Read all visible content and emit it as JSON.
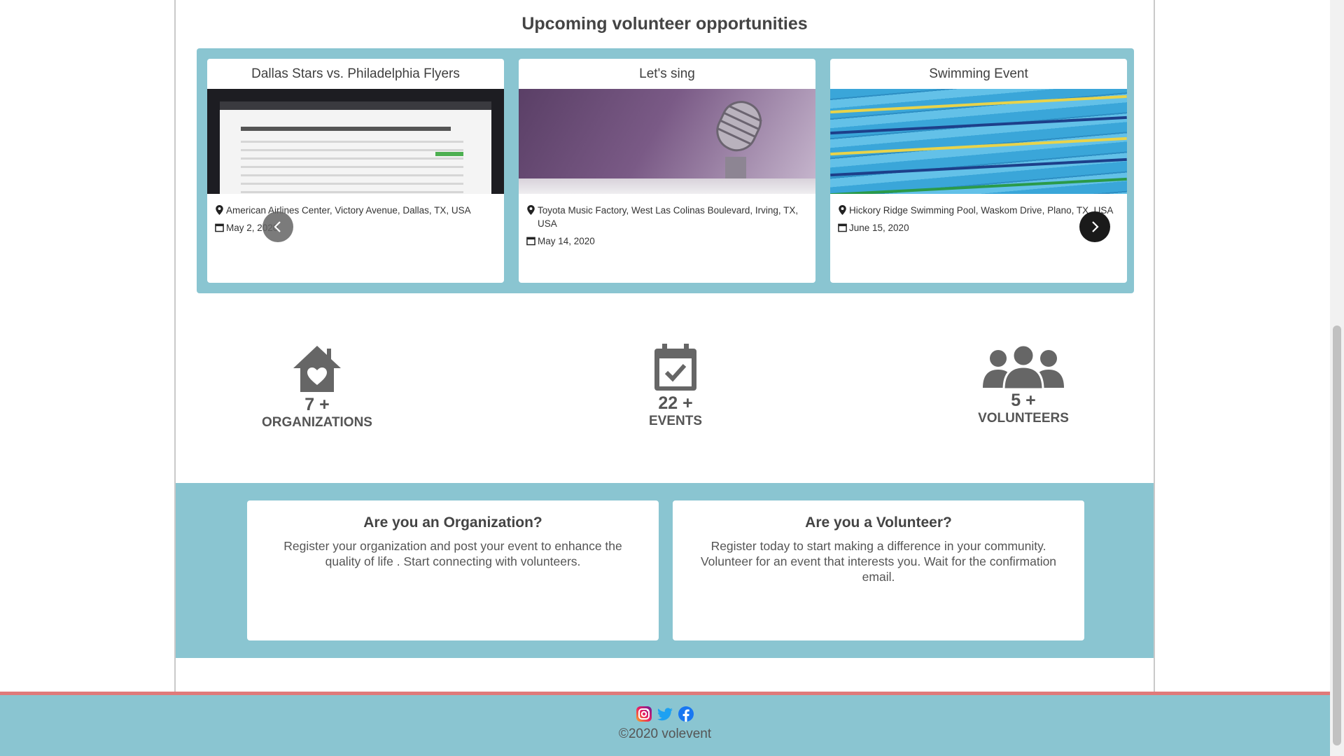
{
  "section_title": "Upcoming volunteer opportunities",
  "cards": [
    {
      "title": "Dallas Stars vs. Philadelphia Flyers",
      "location": "American Airlines Center, Victory Avenue, Dallas, TX, USA",
      "date": "May 2, 2020"
    },
    {
      "title": "Let's sing",
      "location": "Toyota Music Factory, West Las Colinas Boulevard, Irving, TX, USA",
      "date": "May 14, 2020"
    },
    {
      "title": "Swimming Event",
      "location": "Hickory Ridge Swimming Pool, Waskom Drive, Plano, TX, USA",
      "date": "June 15, 2020"
    }
  ],
  "stats": [
    {
      "count": "7 +",
      "label": "ORGANIZATIONS",
      "icon": "house-heart-icon"
    },
    {
      "count": "22 +",
      "label": "EVENTS",
      "icon": "calendar-check-icon"
    },
    {
      "count": "5 +",
      "label": "VOLUNTEERS",
      "icon": "people-icon"
    }
  ],
  "cta": [
    {
      "title": "Are you an Organization?",
      "text": "Register your organization and post your event to enhance the quality of life . Start connecting with volunteers."
    },
    {
      "title": "Are you a Volunteer?",
      "text": "Register today to start making a difference in your community. Volunteer for an event that interests you. Wait for the confirmation email."
    }
  ],
  "footer": {
    "copyright": "©2020 volevent",
    "social": [
      "instagram-icon",
      "twitter-icon",
      "facebook-icon"
    ]
  },
  "colors": {
    "accent": "#8ac5d1",
    "footer_border": "#e07a7a"
  }
}
